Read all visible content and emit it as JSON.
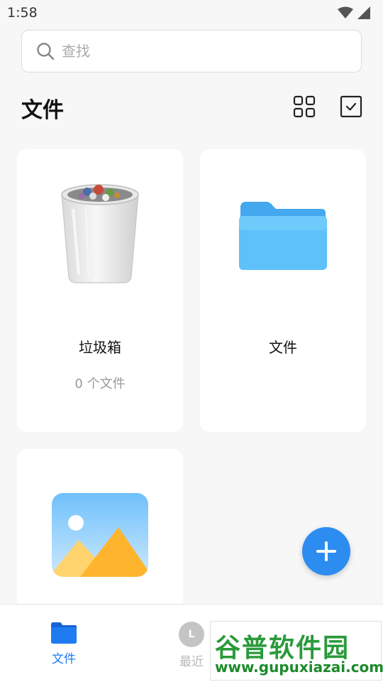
{
  "status_bar": {
    "time": "1:58"
  },
  "search": {
    "placeholder": "查找"
  },
  "header": {
    "title": "文件"
  },
  "cards": [
    {
      "label": "垃圾箱",
      "subtitle": "0 个文件",
      "icon": "trash-icon"
    },
    {
      "label": "文件",
      "icon": "folder-icon"
    },
    {
      "icon": "image-icon"
    }
  ],
  "bottom_nav": {
    "files_label": "文件",
    "recent_label": "最近",
    "recent_icon_text": "L"
  },
  "watermark": {
    "title": "谷普软件园",
    "url": "www.gupuxiazai.com"
  },
  "colors": {
    "accent": "#2d8cf0",
    "nav_active": "#1f7cf0",
    "folder": "#5ec1fa",
    "watermark_green": "#2a9a3a"
  }
}
